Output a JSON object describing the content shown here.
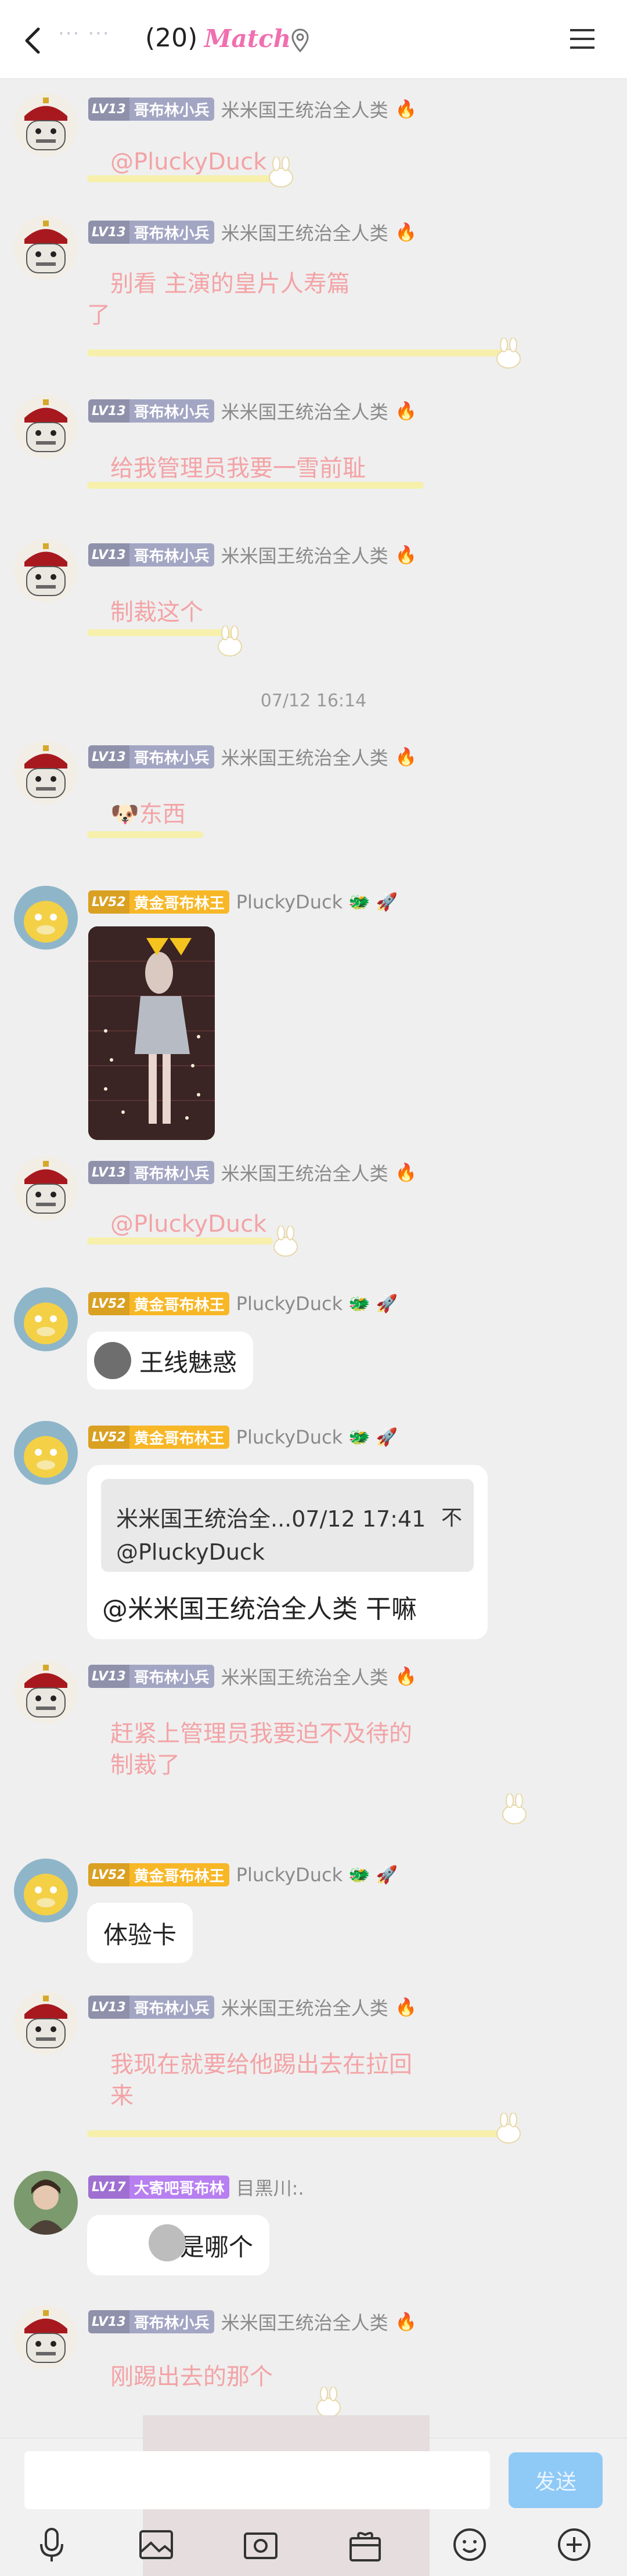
{
  "header": {
    "name_hidden": "··· ···",
    "count": "(20)",
    "brand": "Match",
    "pin_icon": "location-pin-icon",
    "menu_icon": "menu-icon"
  },
  "timestamp": "07/12 16:14",
  "badges": {
    "soldier": {
      "level": "LV13",
      "title": "哥布林小兵",
      "color": "#a3a6c3"
    },
    "king": {
      "level": "LV52",
      "title": "黄金哥布林王",
      "color": "#f7b727"
    },
    "vip": {
      "level": "LV17",
      "title": "大寄吧哥布林",
      "color": "#b77ff0"
    }
  },
  "users": {
    "soldier": "米米国王统治全人类",
    "king": "PluckyDuck",
    "vip": "目黑川:."
  },
  "messages": {
    "m1": "@PluckyDuck",
    "m2_line1": "别看 主演的皇片人寿篇",
    "m2_line2": "了",
    "m3": "给我管理员我要一雪前耻",
    "m4": "制裁这个",
    "m5": "东西",
    "m7": "@PluckyDuck",
    "m8": "王线魅惑",
    "m9_quote_head": "米米国王统治全...07/12 17:41",
    "m9_quote_close": "不",
    "m9_quote_at": "@PluckyDuck",
    "m9_text": "@米米国王统治全人类 干嘛",
    "m10_line1": "赶紧上管理员我要迫不及待的",
    "m10_line2": "制裁了",
    "m11": "体验卡",
    "m12_line1": "我现在就要给他踢出去在拉回",
    "m12_line2": "来",
    "m13": "是哪个",
    "m14": "刚踢出去的那个"
  },
  "input": {
    "placeholder": "",
    "send_label": "发送"
  },
  "toolbar": [
    "microphone-icon",
    "image-icon",
    "camera-icon",
    "gift-box-icon",
    "emoji-icon",
    "plus-icon"
  ]
}
